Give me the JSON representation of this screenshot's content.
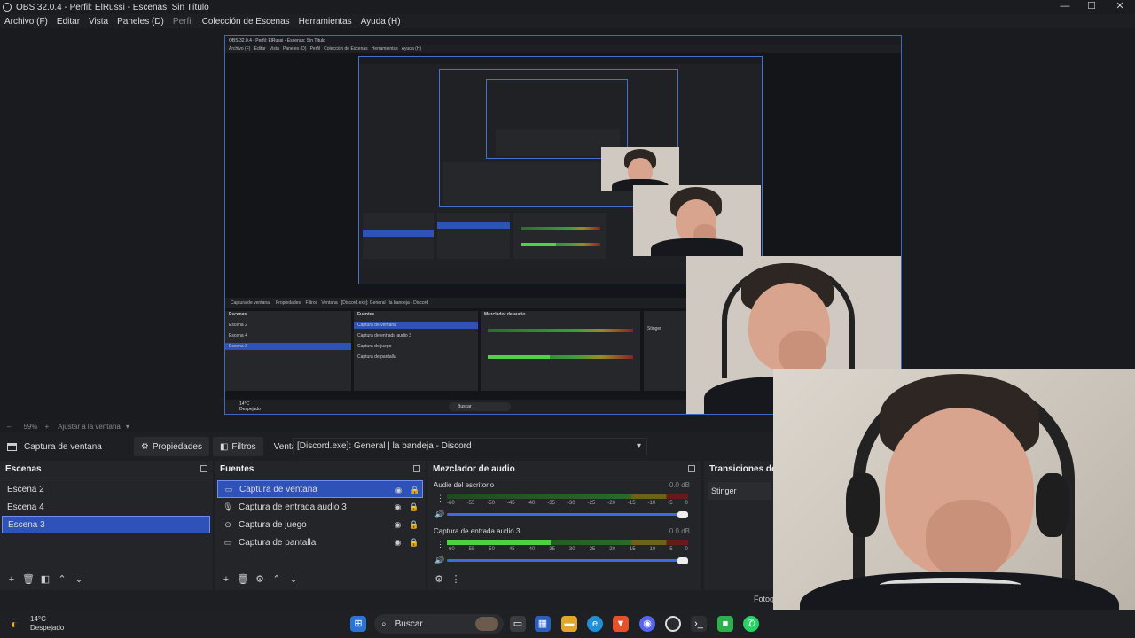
{
  "window": {
    "title": "OBS 32.0.4 - Perfil: ElRussi - Escenas: Sin Título",
    "minimize": "—",
    "maximize": "☐",
    "close": "✕"
  },
  "menu": [
    "Archivo (F)",
    "Editar",
    "Vista",
    "Paneles (D)",
    "Perfil",
    "Colección de Escenas",
    "Herramientas",
    "Ayuda (H)"
  ],
  "preview": {
    "zoom": "59%",
    "fit_label": "Ajustar a la ventana",
    "nested_title": "OBS 32.0.4 - Perfil: ElRussi - Escenas: Sin Título",
    "nested_window_label": "[Discord.exe]: General | la bandeja - Discord",
    "nested_weather_temp": "14°C",
    "nested_weather_desc": "Despejado",
    "nested_search": "Buscar"
  },
  "source_toolbar": {
    "source_name": "Captura de ventana",
    "properties": "Propiedades",
    "filters": "Filtros",
    "window_label": "Ventana",
    "window_value": "[Discord.exe]: General | la bandeja - Discord"
  },
  "scenes": {
    "header": "Escenas",
    "items": [
      "Escena 2",
      "Escena 4",
      "Escena 3"
    ],
    "selected_index": 2
  },
  "sources": {
    "header": "Fuentes",
    "items": [
      {
        "label": "Captura de ventana",
        "icon": "window-icon"
      },
      {
        "label": "Captura de entrada audio 3",
        "icon": "mic-icon"
      },
      {
        "label": "Captura de juego",
        "icon": "gamepad-icon"
      },
      {
        "label": "Captura de pantalla",
        "icon": "monitor-icon"
      }
    ],
    "selected_index": 0
  },
  "mixer": {
    "header": "Mezclador de audio",
    "channels": [
      {
        "name": "Audio del escritorio",
        "db": "0.0 dB",
        "level": 0.0,
        "volume": 1.0
      },
      {
        "name": "Captura de entrada audio 3",
        "db": "0.0 dB",
        "level": 0.43,
        "volume": 1.0
      }
    ],
    "ticks": [
      "-60",
      "-55",
      "-50",
      "-45",
      "-40",
      "-35",
      "-30",
      "-25",
      "-20",
      "-15",
      "-10",
      "-5",
      "0"
    ]
  },
  "transitions": {
    "header": "Transiciones de e",
    "value": "Stinger"
  },
  "status": {
    "partial": "Fotog"
  },
  "taskbar": {
    "weather_temp": "14°C",
    "weather_desc": "Despejado",
    "search": "Buscar"
  }
}
